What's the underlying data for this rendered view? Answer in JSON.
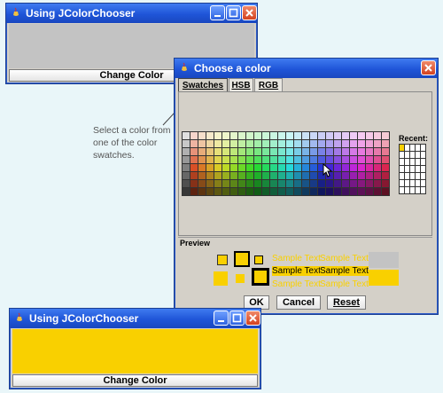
{
  "window_top": {
    "title": "Using JColorChooser",
    "button_label": "Change Color",
    "panel_color": "#c3c3c3"
  },
  "window_bottom": {
    "title": "Using JColorChooser",
    "button_label": "Change Color",
    "panel_color": "#f9d000"
  },
  "dialog": {
    "title": "Choose a color",
    "tabs": [
      "Swatches",
      "HSB",
      "RGB"
    ],
    "recent_label": "Recent:",
    "preview_label": "Preview",
    "sample_text": "Sample Text",
    "buttons": {
      "ok": "OK",
      "cancel": "Cancel",
      "reset": "Reset"
    },
    "selected_color": "#f9d000"
  },
  "annotation": "Select a color from one of the color swatches."
}
